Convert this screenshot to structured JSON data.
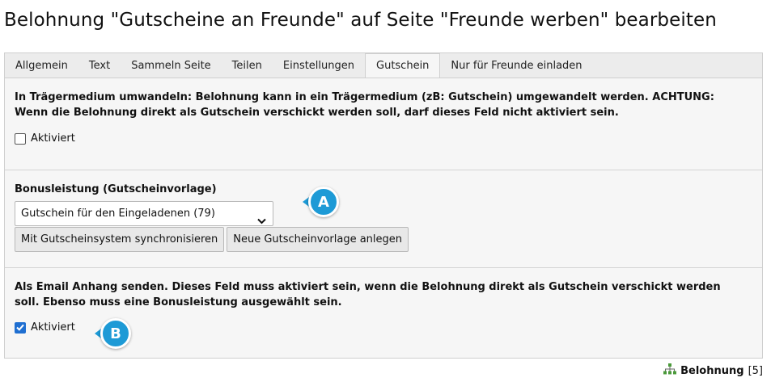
{
  "page": {
    "title": "Belohnung \"Gutscheine an Freunde\" auf Seite \"Freunde werben\" bearbeiten"
  },
  "tabs": [
    {
      "label": "Allgemein",
      "active": false
    },
    {
      "label": "Text",
      "active": false
    },
    {
      "label": "Sammeln Seite",
      "active": false
    },
    {
      "label": "Teilen",
      "active": false
    },
    {
      "label": "Einstellungen",
      "active": false
    },
    {
      "label": "Gutschein",
      "active": true
    },
    {
      "label": "Nur für Freunde einladen",
      "active": false
    }
  ],
  "sections": {
    "carrier": {
      "description": "In Trägermedium umwandeln: Belohnung kann in ein Trägermedium (zB: Gutschein) umgewandelt werden. ACHTUNG: Wenn die Belohnung direkt als Gutschein verschickt werden soll, darf dieses Feld nicht aktiviert sein.",
      "checkbox_label": "Aktiviert",
      "checked": false
    },
    "bonus": {
      "label": "Bonusleistung (Gutscheinvorlage)",
      "selected": "Gutschein für den Eingeladenen (79)",
      "sync_button": "Mit Gutscheinsystem synchronisieren",
      "new_button": "Neue Gutscheinvorlage anlegen"
    },
    "email": {
      "description": "Als Email Anhang senden. Dieses Feld muss aktiviert sein, wenn die Belohnung direkt als Gutschein verschickt werden soll. Ebenso muss eine Bonusleistung ausgewählt sein.",
      "checkbox_label": "Aktiviert",
      "checked": true
    }
  },
  "markers": {
    "a": "A",
    "b": "B",
    "color": "#1d9ad6"
  },
  "footer": {
    "record_type": "Belohnung",
    "record_id": "[5]",
    "icon": "sitemap-icon"
  }
}
